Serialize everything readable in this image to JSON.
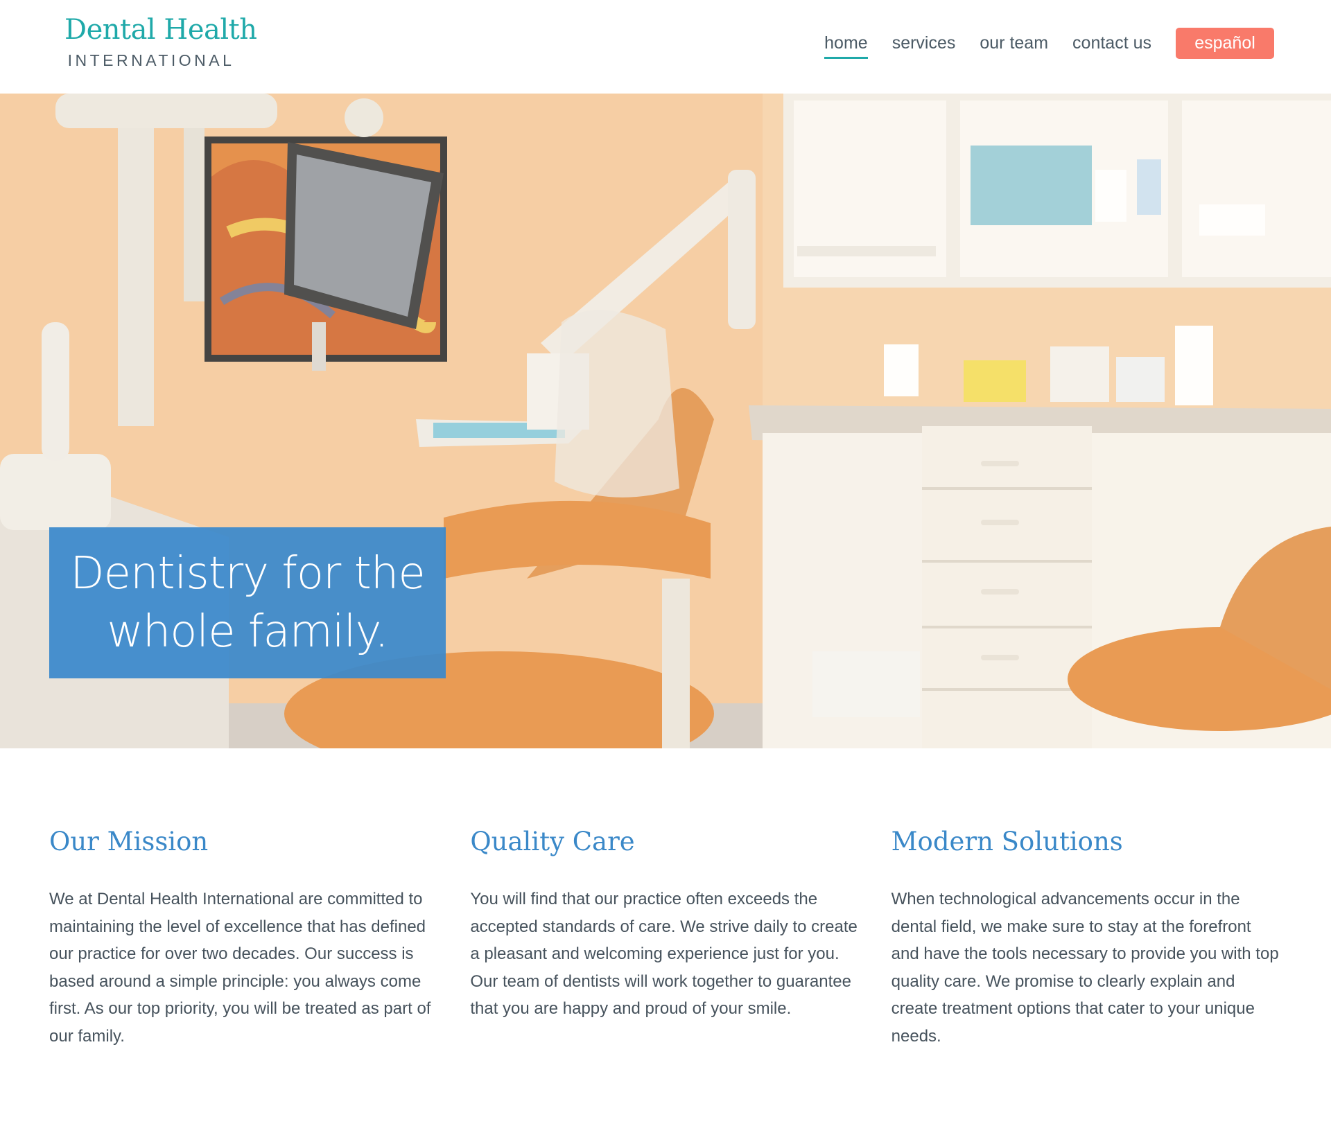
{
  "brand": {
    "title": "Dental Health",
    "subtitle": "INTERNATIONAL"
  },
  "nav": {
    "items": [
      {
        "label": "home",
        "active": true
      },
      {
        "label": "services",
        "active": false
      },
      {
        "label": "our team",
        "active": false
      },
      {
        "label": "contact us",
        "active": false
      }
    ],
    "cta_label": "español"
  },
  "hero": {
    "headline_line1": "Dentistry for the",
    "headline_line2": "whole family."
  },
  "features": [
    {
      "title": "Our Mission",
      "text": "We at Dental Health International are committed to maintaining the level of excellence that has defined our practice for over two decades. Our success is based around a simple principle: you always come first. As our top priority, you will be treated as part of our family."
    },
    {
      "title": "Quality Care",
      "text": "You will find that our practice often exceeds the accepted standards of care. We strive daily to create a pleasant and welcoming experience just for you. Our team of dentists will work together to guarantee that you are happy and proud of your smile."
    },
    {
      "title": "Modern Solutions",
      "text": "When technological advancements occur in the dental field, we make sure to stay at the forefront and have the tools necessary to provide you with top quality care. We promise to clearly explain and create treatment options that cater to your unique needs."
    }
  ],
  "colors": {
    "brand_teal": "#1fa9a9",
    "heading_blue": "#3a88c8",
    "cta_coral": "#f97a6a",
    "hero_card_blue": "#3a89cb",
    "body_text": "#46525c"
  }
}
